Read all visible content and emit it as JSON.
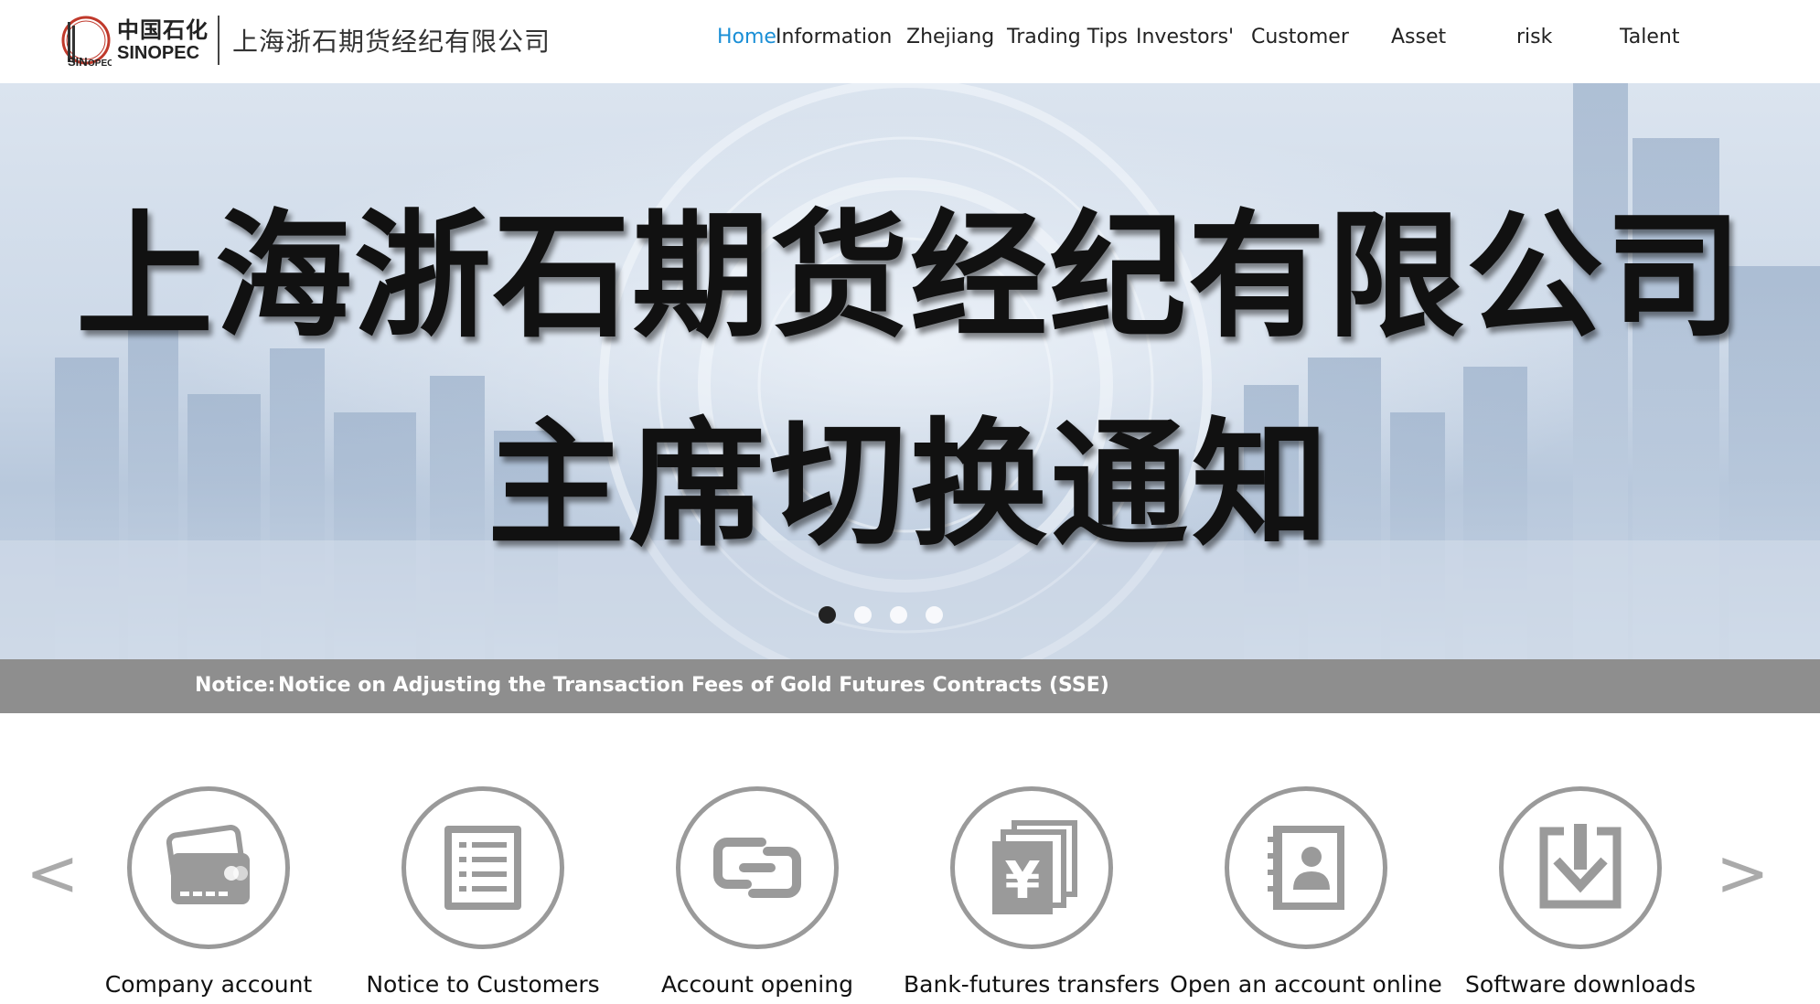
{
  "header": {
    "logo_cn": "中国石化",
    "logo_en": "SINOPEC",
    "company_name": "上海浙石期货经纪有限公司"
  },
  "nav": {
    "items": [
      {
        "label": "Home",
        "active": true
      },
      {
        "label": "Information"
      },
      {
        "label": "Zhejiang"
      },
      {
        "label": "Trading Tips"
      },
      {
        "label": "Investors'"
      },
      {
        "label": "Customer"
      },
      {
        "label": "Asset"
      },
      {
        "label": "risk"
      },
      {
        "label": "Talent"
      }
    ]
  },
  "banner": {
    "line1": "上海浙石期货经纪有限公司",
    "line2": "主席切换通知",
    "slide_count": 4,
    "active_slide": 1
  },
  "notice": {
    "label": "Notice:",
    "text": "Notice on Adjusting the Transaction Fees of Gold Futures Contracts (SSE)"
  },
  "services": {
    "prev_arrow": "<",
    "next_arrow": ">",
    "items": [
      {
        "label": "Company account",
        "icon": "card-icon"
      },
      {
        "label": "Notice to Customers",
        "icon": "list-icon"
      },
      {
        "label": "Account opening",
        "icon": "link-icon"
      },
      {
        "label": "Bank-futures transfers",
        "icon": "yen-icon"
      },
      {
        "label": "Open an account online",
        "icon": "contact-book-icon"
      },
      {
        "label": "Software downloads",
        "icon": "download-icon"
      }
    ]
  },
  "colors": {
    "nav_active": "#1a8fd6",
    "notice_bar": "#8e8e8e",
    "icon_gray": "#9a9a9a"
  }
}
